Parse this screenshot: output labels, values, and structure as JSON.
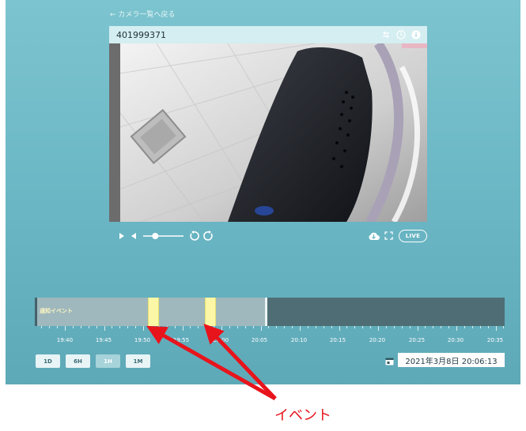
{
  "nav": {
    "back_label": "← カメラ一覧へ戻る"
  },
  "camera": {
    "id": "401999371",
    "header_icons": [
      "swap-icon",
      "clock-icon",
      "info-icon"
    ]
  },
  "player": {
    "controls": [
      "play-icon",
      "volume-icon",
      "volume-slider",
      "rewind-icon",
      "forward-icon"
    ],
    "volume_level": 0.3,
    "right_controls": [
      "cloud-download-icon",
      "fullscreen-icon"
    ],
    "live_label": "LIVE"
  },
  "timeline": {
    "track_label": "通知イベント",
    "tick_labels": [
      "19:40",
      "19:45",
      "19:50",
      "19:55",
      "20:00",
      "20:05",
      "20:10",
      "20:15",
      "20:20",
      "20:25",
      "20:30",
      "20:35"
    ],
    "event_times": [
      "19:50",
      "19:58"
    ],
    "now_time": "20:06"
  },
  "range_buttons": [
    {
      "label": "1D"
    },
    {
      "label": "6H"
    },
    {
      "label": "1H",
      "active": true
    },
    {
      "label": "1M"
    }
  ],
  "datetime": "2021年3月8日 20:06:13",
  "annotation": {
    "label": "イベント",
    "color": "#e8141c"
  },
  "colors": {
    "background": "#6ab6c4",
    "timeline_recorded": "#9fb8bd",
    "timeline_future": "#4f6d74",
    "event": "#fbf7a6"
  }
}
